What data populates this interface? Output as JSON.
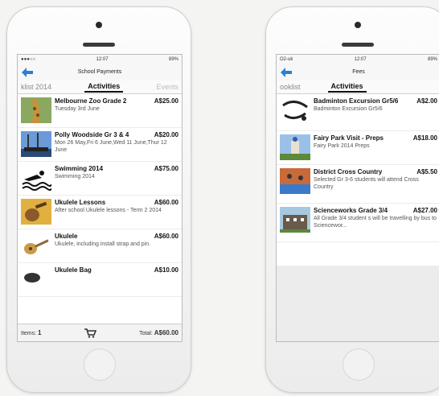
{
  "left": {
    "status": {
      "time": "12:07",
      "battery": "89%"
    },
    "nav_title": "School Payments",
    "tabs": [
      {
        "label": "klist 2014"
      },
      {
        "label": "Activities"
      },
      {
        "label": "Events"
      }
    ],
    "items": [
      {
        "title": "Melbourne Zoo Grade 2",
        "price": "A$25.00",
        "desc": "Tuesday 3rd June",
        "thumb_icon": "giraffe-photo",
        "thumb_color": "#b08a3a"
      },
      {
        "title": "Polly Woodside Gr 3 & 4",
        "price": "A$20.00",
        "desc": "Mon 26 May,Fri 6 June,Wed 11 June,Thur 12 June",
        "thumb_icon": "ship-photo",
        "thumb_color": "#3b6aa8"
      },
      {
        "title": "Swimming 2014",
        "price": "A$75.00",
        "desc": "Swimming 2014",
        "thumb_icon": "swimmer-icon",
        "thumb_color": "#111111"
      },
      {
        "title": "Ukulele Lessons",
        "price": "A$60.00",
        "desc": "After school Ukulele lessons - Term 2 2014",
        "thumb_icon": "ukulele-photo",
        "thumb_color": "#d8a12a"
      },
      {
        "title": "Ukulele",
        "price": "A$60.00",
        "desc": "Ukulele, including install strap and pin.",
        "thumb_icon": "ukulele-icon",
        "thumb_color": "#c99a4a"
      },
      {
        "title": "Ukulele Bag",
        "price": "A$10.00",
        "desc": "",
        "thumb_icon": "bag-icon",
        "thumb_color": "#333333"
      }
    ],
    "footer": {
      "items_label": "Items:",
      "items_count": "1",
      "total_label": "Total:",
      "total_value": "A$60.00"
    }
  },
  "right": {
    "status": {
      "carrier": "O2-uk",
      "time": "12:07",
      "battery": "89%"
    },
    "nav_title": "Fees",
    "tabs": [
      {
        "label": "ooklist"
      },
      {
        "label": "Activities"
      }
    ],
    "items": [
      {
        "title": "Badminton Excursion Gr5/6",
        "price": "A$2.00",
        "desc": "Badminton Excursion Gr5/6",
        "thumb_icon": "badminton-icon",
        "thumb_color": "#222222"
      },
      {
        "title": "Fairy Park Visit - Preps",
        "price": "A$18.00",
        "desc": "Fairy Park 2014 Preps",
        "thumb_icon": "castle-photo",
        "thumb_color": "#6a8fb8"
      },
      {
        "title": "District Cross Country",
        "price": "A$5.50",
        "desc": "Selected Gr 3-6 students will attend Cross Country",
        "thumb_icon": "running-photo",
        "thumb_color": "#b85a3a"
      },
      {
        "title": "Scienceworks Grade 3/4",
        "price": "A$27.00",
        "desc": "All Grade 3/4 student s will be travelling by bus to Sciencewor...",
        "thumb_icon": "building-photo",
        "thumb_color": "#6a8a5a"
      }
    ]
  },
  "colors": {
    "accent": "#2a7fd4"
  }
}
